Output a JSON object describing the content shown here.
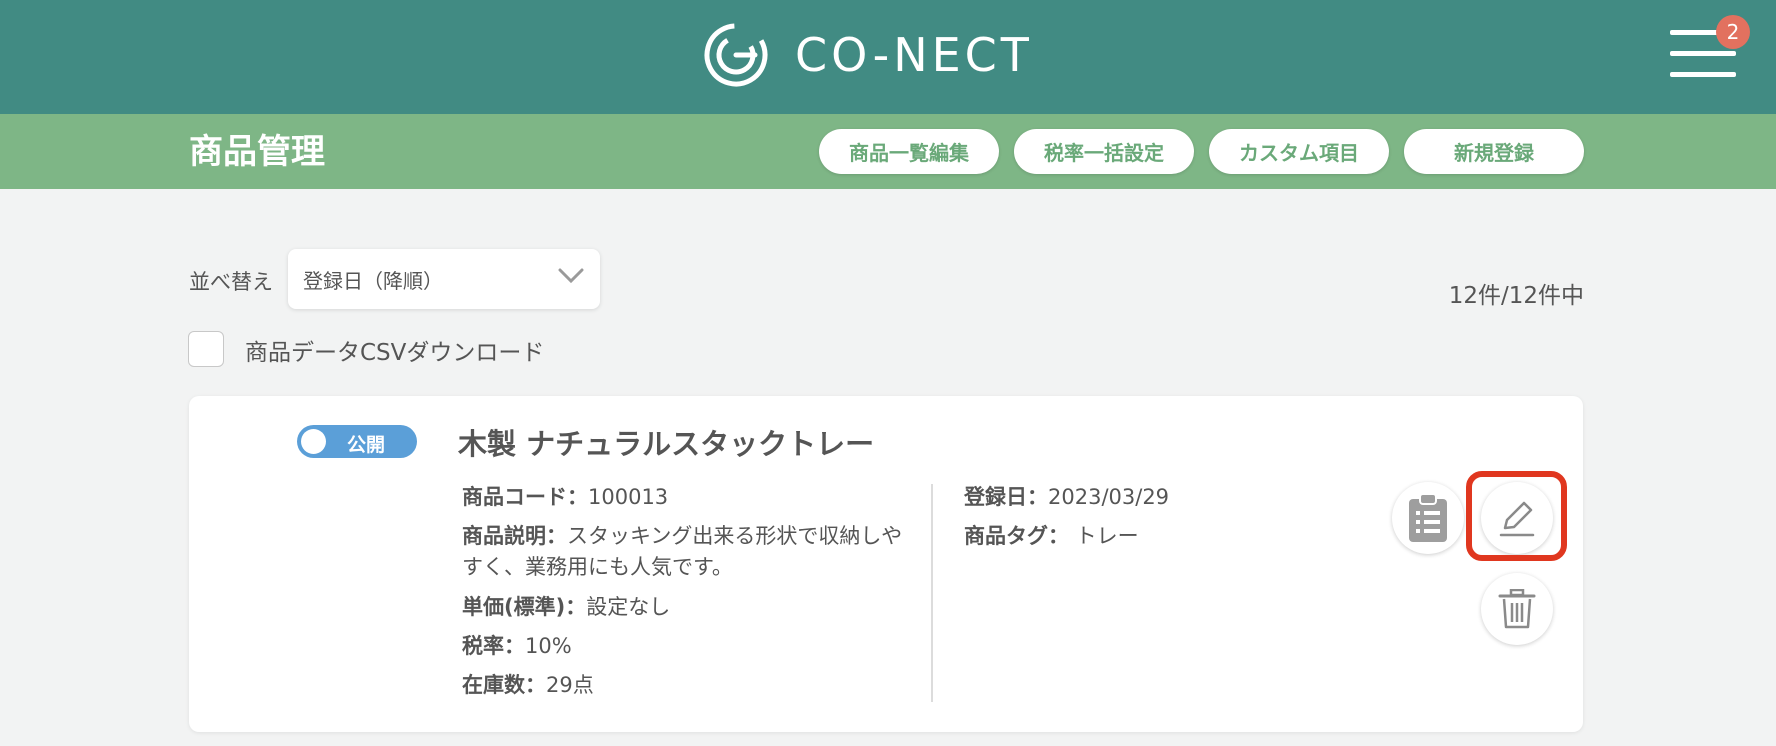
{
  "header": {
    "brand": "CO-NECT",
    "notification_count": "2",
    "colors": {
      "header_bg": "#418b83",
      "subheader_bg": "#7eb686",
      "badge": "#e2715f",
      "highlight": "#e0371f"
    }
  },
  "subheader": {
    "title": "商品管理",
    "buttons": [
      "商品一覧編集",
      "税率一括設定",
      "カスタム項目",
      "新規登録"
    ]
  },
  "controls": {
    "sort_label": "並べ替え",
    "sort_value": "登録日（降順）",
    "count": "12件/12件中",
    "csv_label": "商品データCSVダウンロード",
    "csv_checked": false
  },
  "product": {
    "status": "公開",
    "name": "木製 ナチュラルスタックトレー",
    "fields": {
      "code_label": "商品コード：",
      "code": "100013",
      "desc_label": "商品説明：",
      "desc_line1": "スタッキング出来る形状で収納しや",
      "desc_line2": "すく、業務用にも人気です。",
      "price_label": "単価(標準)：",
      "price": "設定なし",
      "tax_label": "税率：",
      "tax": "10%",
      "stock_label": "在庫数：",
      "stock": "29点",
      "date_label": "登録日：",
      "date": "2023/03/29",
      "tag_label": "商品タグ：",
      "tag": " トレー"
    },
    "actions": [
      "clipboard-icon",
      "edit-pencil-icon",
      "trash-icon"
    ]
  }
}
